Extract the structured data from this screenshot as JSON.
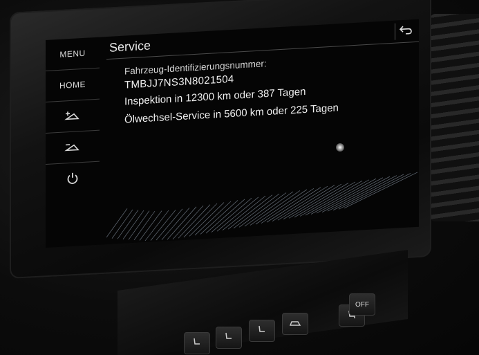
{
  "sidebar": {
    "menu_label": "MENU",
    "home_label": "HOME"
  },
  "header": {
    "title": "Service"
  },
  "service": {
    "vin_label": "Fahrzeug-Identifizierungsnummer:",
    "vin_value": "TMBJJ7NS3N8021504",
    "inspection": "Inspektion in 12300 km oder 387 Tagen",
    "oil_change": "Ölwechsel-Service in 5600 km oder 225 Tagen"
  },
  "console": {
    "off_label": "OFF"
  },
  "colors": {
    "screen_bg": "#050505",
    "text": "#f0f0f0",
    "divider": "#4a4a4a"
  },
  "icons": {
    "brightness_up": "brightness-up-icon",
    "brightness_down": "brightness-down-icon",
    "power": "power-icon",
    "back": "back-arrow-icon"
  }
}
